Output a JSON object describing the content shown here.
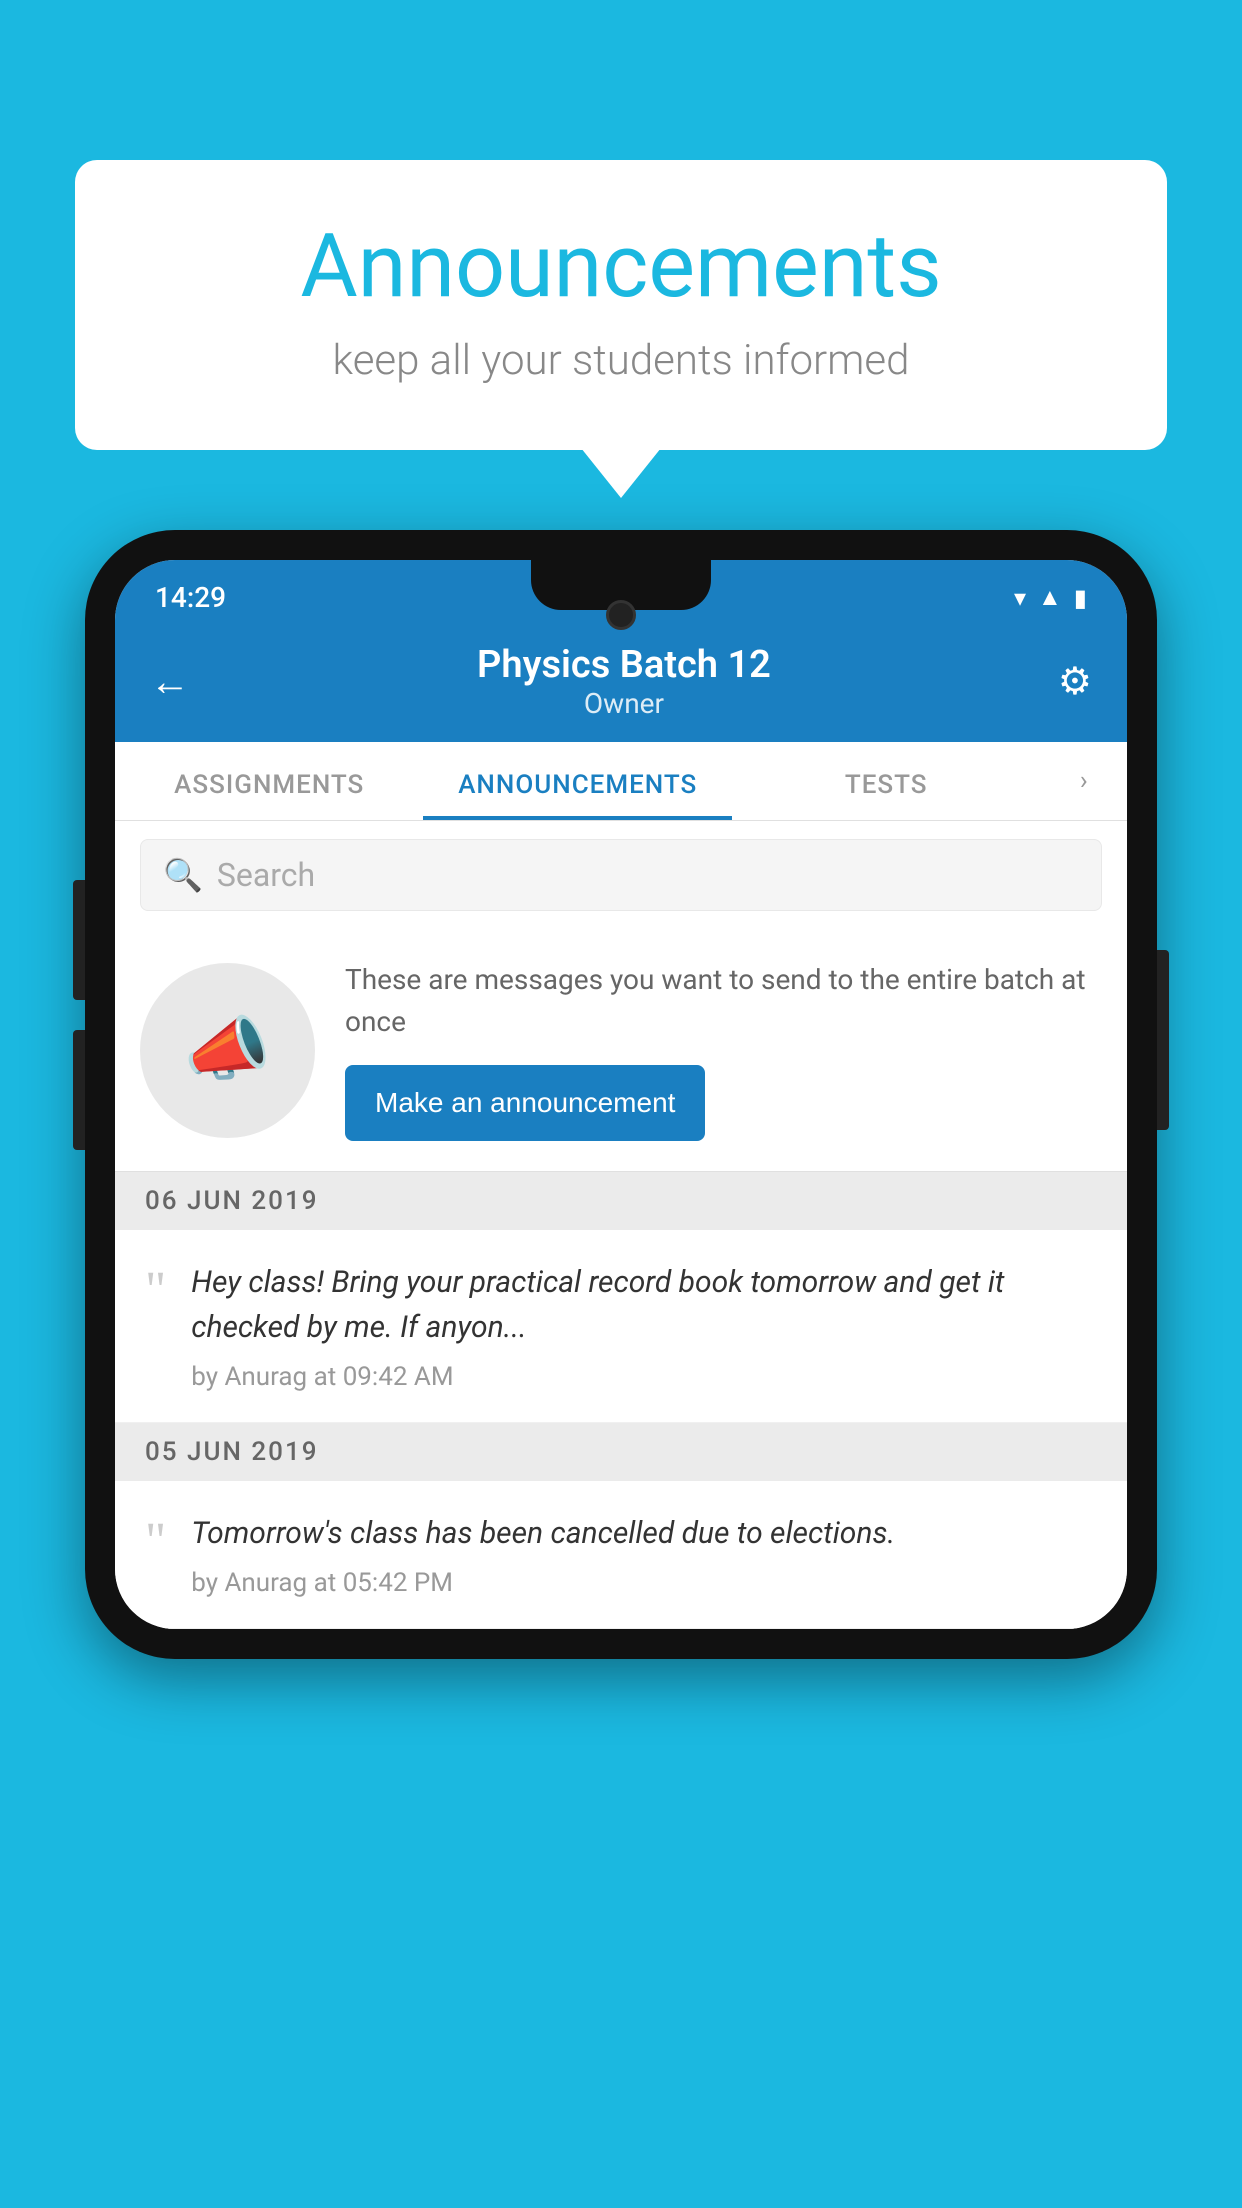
{
  "page": {
    "background_color": "#1BB8E0"
  },
  "speech_bubble": {
    "title": "Announcements",
    "subtitle": "keep all your students informed"
  },
  "status_bar": {
    "time": "14:29",
    "wifi": "▾",
    "signal": "▲",
    "battery": "▮"
  },
  "header": {
    "title": "Physics Batch 12",
    "subtitle": "Owner",
    "back_label": "←",
    "settings_label": "⚙"
  },
  "tabs": [
    {
      "label": "ASSIGNMENTS",
      "active": false
    },
    {
      "label": "ANNOUNCEMENTS",
      "active": true
    },
    {
      "label": "TESTS",
      "active": false
    }
  ],
  "search": {
    "placeholder": "Search"
  },
  "promo": {
    "text": "These are messages you want to send to the entire batch at once",
    "button_label": "Make an announcement"
  },
  "announcements": [
    {
      "date": "06  JUN  2019",
      "text": "Hey class! Bring your practical record book tomorrow and get it checked by me. If anyon...",
      "by": "by Anurag at 09:42 AM"
    },
    {
      "date": "05  JUN  2019",
      "text": "Tomorrow's class has been cancelled due to elections.",
      "by": "by Anurag at 05:42 PM"
    }
  ]
}
